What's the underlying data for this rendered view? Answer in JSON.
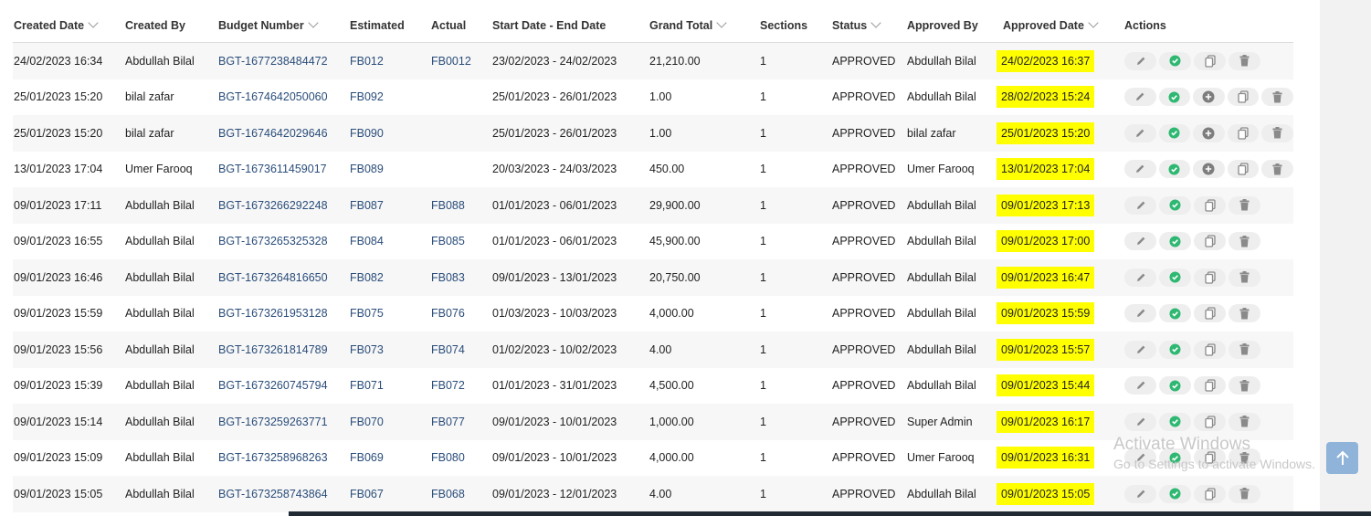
{
  "table": {
    "columns": [
      {
        "label": "Created Date",
        "sortable": true
      },
      {
        "label": "Created By",
        "sortable": false
      },
      {
        "label": "Budget Number",
        "sortable": true
      },
      {
        "label": "Estimated",
        "sortable": false
      },
      {
        "label": "Actual",
        "sortable": false
      },
      {
        "label": "Start Date - End Date",
        "sortable": false
      },
      {
        "label": "Grand Total",
        "sortable": true
      },
      {
        "label": "Sections",
        "sortable": false
      },
      {
        "label": "Status",
        "sortable": true
      },
      {
        "label": "Approved By",
        "sortable": false
      },
      {
        "label": "Approved Date",
        "sortable": true
      },
      {
        "label": "Actions",
        "sortable": false
      }
    ],
    "rows": [
      {
        "created_date": "24/02/2023 16:34",
        "created_by": "Abdullah Bilal",
        "budget_number": "BGT-1677238484472",
        "estimated": "FB012",
        "actual": "FB0012",
        "date_range": "23/02/2023 - 24/02/2023",
        "grand_total": "21,210.00",
        "sections": "1",
        "status": "APPROVED",
        "approved_by": "Abdullah Bilal",
        "approved_date": "24/02/2023 16:37",
        "actions": [
          "edit",
          "approve",
          "copy",
          "delete"
        ]
      },
      {
        "created_date": "25/01/2023 15:20",
        "created_by": "bilal zafar",
        "budget_number": "BGT-1674642050060",
        "estimated": "FB092",
        "actual": "",
        "date_range": "25/01/2023 - 26/01/2023",
        "grand_total": "1.00",
        "sections": "1",
        "status": "APPROVED",
        "approved_by": "Abdullah Bilal",
        "approved_date": "28/02/2023 15:24",
        "actions": [
          "edit",
          "approve",
          "add",
          "copy",
          "delete"
        ]
      },
      {
        "created_date": "25/01/2023 15:20",
        "created_by": "bilal zafar",
        "budget_number": "BGT-1674642029646",
        "estimated": "FB090",
        "actual": "",
        "date_range": "25/01/2023 - 26/01/2023",
        "grand_total": "1.00",
        "sections": "1",
        "status": "APPROVED",
        "approved_by": "bilal zafar",
        "approved_date": "25/01/2023 15:20",
        "actions": [
          "edit",
          "approve",
          "add",
          "copy",
          "delete"
        ]
      },
      {
        "created_date": "13/01/2023 17:04",
        "created_by": "Umer Farooq",
        "budget_number": "BGT-1673611459017",
        "estimated": "FB089",
        "actual": "",
        "date_range": "20/03/2023 - 24/03/2023",
        "grand_total": "450.00",
        "sections": "1",
        "status": "APPROVED",
        "approved_by": "Umer Farooq",
        "approved_date": "13/01/2023 17:04",
        "actions": [
          "edit",
          "approve",
          "add",
          "copy",
          "delete"
        ]
      },
      {
        "created_date": "09/01/2023 17:11",
        "created_by": "Abdullah Bilal",
        "budget_number": "BGT-1673266292248",
        "estimated": "FB087",
        "actual": "FB088",
        "date_range": "01/01/2023 - 06/01/2023",
        "grand_total": "29,900.00",
        "sections": "1",
        "status": "APPROVED",
        "approved_by": "Abdullah Bilal",
        "approved_date": "09/01/2023 17:13",
        "actions": [
          "edit",
          "approve",
          "copy",
          "delete"
        ]
      },
      {
        "created_date": "09/01/2023 16:55",
        "created_by": "Abdullah Bilal",
        "budget_number": "BGT-1673265325328",
        "estimated": "FB084",
        "actual": "FB085",
        "date_range": "01/01/2023 - 06/01/2023",
        "grand_total": "45,900.00",
        "sections": "1",
        "status": "APPROVED",
        "approved_by": "Abdullah Bilal",
        "approved_date": "09/01/2023 17:00",
        "actions": [
          "edit",
          "approve",
          "copy",
          "delete"
        ]
      },
      {
        "created_date": "09/01/2023 16:46",
        "created_by": "Abdullah Bilal",
        "budget_number": "BGT-1673264816650",
        "estimated": "FB082",
        "actual": "FB083",
        "date_range": "09/01/2023 - 13/01/2023",
        "grand_total": "20,750.00",
        "sections": "1",
        "status": "APPROVED",
        "approved_by": "Abdullah Bilal",
        "approved_date": "09/01/2023 16:47",
        "actions": [
          "edit",
          "approve",
          "copy",
          "delete"
        ]
      },
      {
        "created_date": "09/01/2023 15:59",
        "created_by": "Abdullah Bilal",
        "budget_number": "BGT-1673261953128",
        "estimated": "FB075",
        "actual": "FB076",
        "date_range": "01/03/2023 - 10/03/2023",
        "grand_total": "4,000.00",
        "sections": "1",
        "status": "APPROVED",
        "approved_by": "Abdullah Bilal",
        "approved_date": "09/01/2023 15:59",
        "actions": [
          "edit",
          "approve",
          "copy",
          "delete"
        ]
      },
      {
        "created_date": "09/01/2023 15:56",
        "created_by": "Abdullah Bilal",
        "budget_number": "BGT-1673261814789",
        "estimated": "FB073",
        "actual": "FB074",
        "date_range": "01/02/2023 - 10/02/2023",
        "grand_total": "4.00",
        "sections": "1",
        "status": "APPROVED",
        "approved_by": "Abdullah Bilal",
        "approved_date": "09/01/2023 15:57",
        "actions": [
          "edit",
          "approve",
          "copy",
          "delete"
        ]
      },
      {
        "created_date": "09/01/2023 15:39",
        "created_by": "Abdullah Bilal",
        "budget_number": "BGT-1673260745794",
        "estimated": "FB071",
        "actual": "FB072",
        "date_range": "01/01/2023 - 31/01/2023",
        "grand_total": "4,500.00",
        "sections": "1",
        "status": "APPROVED",
        "approved_by": "Abdullah Bilal",
        "approved_date": "09/01/2023 15:44",
        "actions": [
          "edit",
          "approve",
          "copy",
          "delete"
        ]
      },
      {
        "created_date": "09/01/2023 15:14",
        "created_by": "Abdullah Bilal",
        "budget_number": "BGT-1673259263771",
        "estimated": "FB070",
        "actual": "FB077",
        "date_range": "09/01/2023 - 10/01/2023",
        "grand_total": "1,000.00",
        "sections": "1",
        "status": "APPROVED",
        "approved_by": "Super Admin",
        "approved_date": "09/01/2023 16:17",
        "actions": [
          "edit",
          "approve",
          "copy",
          "delete"
        ]
      },
      {
        "created_date": "09/01/2023 15:09",
        "created_by": "Abdullah Bilal",
        "budget_number": "BGT-1673258968263",
        "estimated": "FB069",
        "actual": "FB080",
        "date_range": "09/01/2023 - 10/01/2023",
        "grand_total": "4,000.00",
        "sections": "1",
        "status": "APPROVED",
        "approved_by": "Umer Farooq",
        "approved_date": "09/01/2023 16:31",
        "actions": [
          "edit",
          "approve",
          "copy",
          "delete"
        ]
      },
      {
        "created_date": "09/01/2023 15:05",
        "created_by": "Abdullah Bilal",
        "budget_number": "BGT-1673258743864",
        "estimated": "FB067",
        "actual": "FB068",
        "date_range": "09/01/2023 - 12/01/2023",
        "grand_total": "4.00",
        "sections": "1",
        "status": "APPROVED",
        "approved_by": "Abdullah Bilal",
        "approved_date": "09/01/2023 15:05",
        "actions": [
          "edit",
          "approve",
          "copy",
          "delete"
        ]
      }
    ]
  },
  "overlay": {
    "activate_title": "Activate Windows",
    "activate_subtitle": "Go to Settings to activate Windows."
  },
  "colors": {
    "highlight": "#ffff00",
    "link": "#2a4d7a",
    "approve_icon": "#2eb872",
    "action_icon": "#8a8a8a",
    "scroll_button": "#8fb3d9"
  }
}
